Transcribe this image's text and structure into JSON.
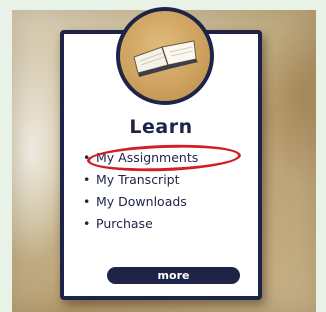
{
  "card": {
    "title": "Learn",
    "icon": "open-book-icon",
    "menu": [
      {
        "label": "My Assignments"
      },
      {
        "label": "My Transcript"
      },
      {
        "label": "My Downloads"
      },
      {
        "label": "Purchase"
      }
    ],
    "bullet": "•",
    "more_label": "more"
  },
  "colors": {
    "accent": "#1e2447",
    "highlight": "#d21f26",
    "medallion": "#cfa260",
    "background": "#e8f2e6"
  }
}
